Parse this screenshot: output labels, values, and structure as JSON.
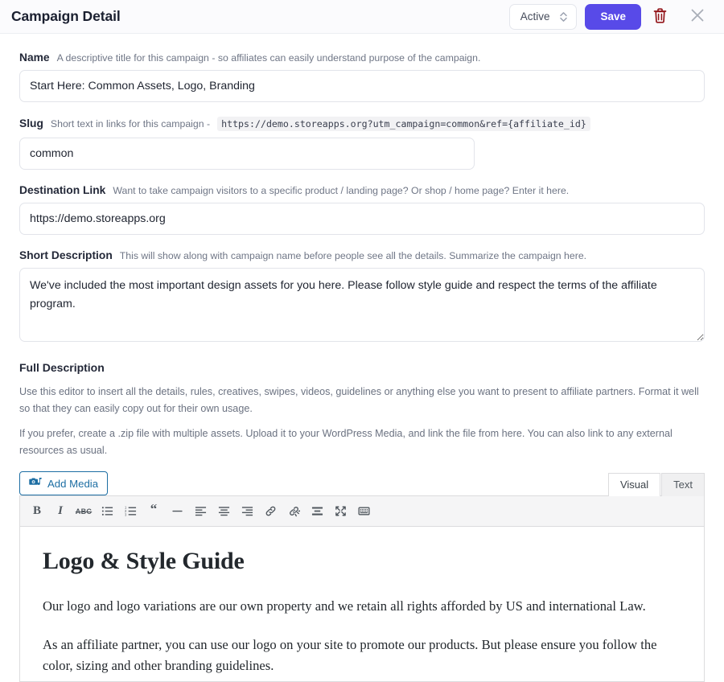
{
  "header": {
    "title": "Campaign Detail",
    "status_value": "Active",
    "save_label": "Save",
    "delete_icon": "trash-icon",
    "close_icon": "close-icon",
    "sort_icon": "chevron-up-down-icon",
    "accent_color": "#584ae8",
    "delete_color": "#93151a"
  },
  "fields": {
    "name": {
      "label": "Name",
      "hint": "A descriptive title for this campaign - so affiliates can easily understand purpose of the campaign.",
      "value": "Start Here: Common Assets, Logo, Branding",
      "placeholder": ""
    },
    "slug": {
      "label": "Slug",
      "hint": "Short text in links for this campaign -",
      "code": "https://demo.storeapps.org?utm_campaign=common&ref={affiliate_id}",
      "value": "common",
      "placeholder": ""
    },
    "destination": {
      "label": "Destination Link",
      "hint": "Want to take campaign visitors to a specific product / landing page? Or shop / home page? Enter it here.",
      "value": "https://demo.storeapps.org",
      "placeholder": ""
    },
    "short_description": {
      "label": "Short Description",
      "hint": "This will show along with campaign name before people see all the details. Summarize the campaign here.",
      "value": "We've included the most important design assets for you here. Please follow style guide and respect the terms of the affiliate program.",
      "placeholder": ""
    }
  },
  "full_description": {
    "title": "Full Description",
    "help_1": "Use this editor to insert all the details, rules, creatives, swipes, videos, guidelines or anything else you want to present to affiliate partners. Format it well so that they can easily copy out for their own usage.",
    "help_2": "If you prefer, create a .zip file with multiple assets. Upload it to your WordPress Media, and link the file from here. You can also link to any external resources as usual."
  },
  "editor": {
    "add_media_label": "Add Media",
    "add_media_icon": "add-media-icon",
    "tabs": [
      {
        "label": "Visual",
        "active": true
      },
      {
        "label": "Text",
        "active": false
      }
    ],
    "toolbar": [
      {
        "name": "bold-icon",
        "glyph": "B"
      },
      {
        "name": "italic-icon",
        "glyph": "I"
      },
      {
        "name": "strikethrough-icon",
        "glyph": "ABC"
      },
      {
        "name": "bulleted-list-icon",
        "glyph": ""
      },
      {
        "name": "numbered-list-icon",
        "glyph": ""
      },
      {
        "name": "blockquote-icon",
        "glyph": "“"
      },
      {
        "name": "horizontal-rule-icon",
        "glyph": ""
      },
      {
        "name": "align-left-icon",
        "glyph": ""
      },
      {
        "name": "align-center-icon",
        "glyph": ""
      },
      {
        "name": "align-right-icon",
        "glyph": ""
      },
      {
        "name": "insert-link-icon",
        "glyph": ""
      },
      {
        "name": "remove-link-icon",
        "glyph": ""
      },
      {
        "name": "read-more-icon",
        "glyph": ""
      },
      {
        "name": "fullscreen-icon",
        "glyph": ""
      },
      {
        "name": "toolbar-toggle-icon",
        "glyph": ""
      }
    ],
    "content": {
      "heading": "Logo & Style Guide",
      "paragraph_1": "Our logo and logo variations are our own property and we retain all rights afforded by US and international Law.",
      "paragraph_2": "As an affiliate partner, you can use our logo on your site to promote our products. But please ensure you follow the color, sizing and other branding guidelines."
    }
  }
}
